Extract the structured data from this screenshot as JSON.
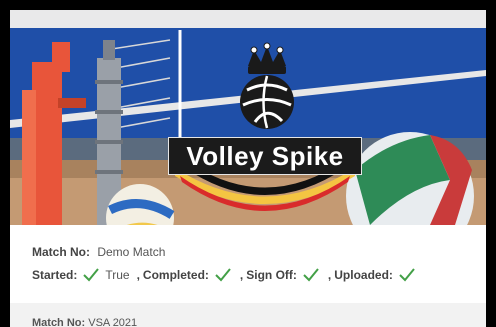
{
  "banner": {
    "title": "Volley Spike"
  },
  "match": {
    "match_no_label": "Match No:",
    "match_no_value": "Demo Match",
    "started_label": "Started:",
    "started_value": "True",
    "completed_label": "Completed:",
    "signoff_label": "Sign Off:",
    "uploaded_label": "Uploaded:",
    "separator": ","
  },
  "next_match": {
    "match_no_label": "Match No:",
    "match_no_value": "VSA 2021"
  },
  "colors": {
    "check": "#43a047",
    "banner_blue": "#1f4fa8",
    "banner_orange": "#e8553a"
  },
  "icons": [
    "check-icon",
    "crown-icon",
    "volleyball-icon"
  ]
}
